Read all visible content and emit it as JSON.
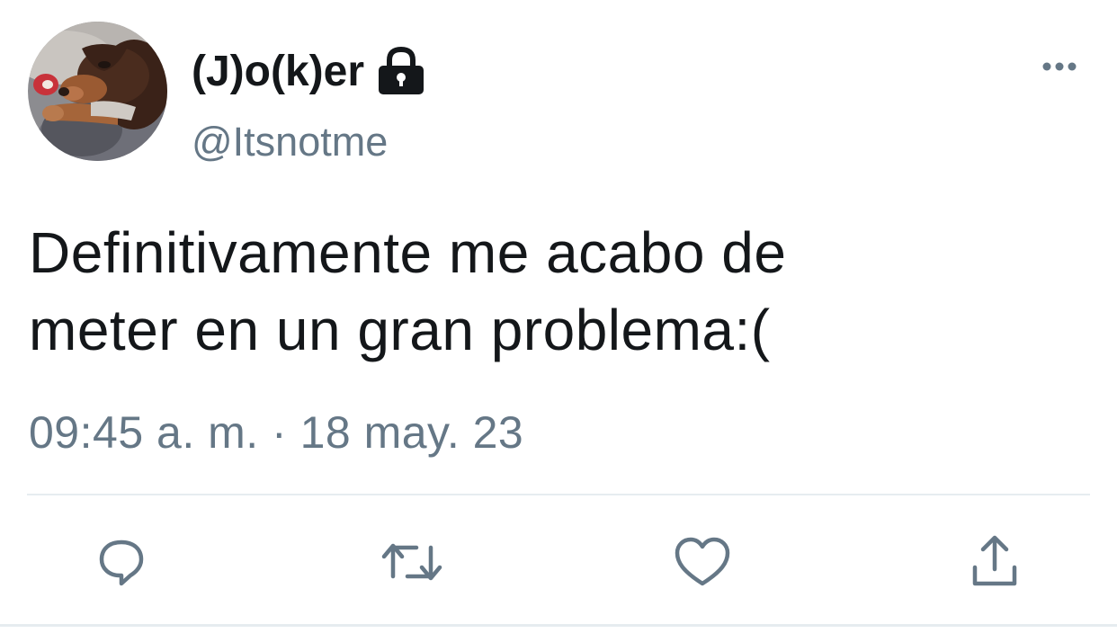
{
  "author": {
    "display_name": "(J)o(k)er",
    "handle": "@Itsnotme",
    "protected_icon": "lock-icon",
    "avatar": "puppy-photo"
  },
  "tweet": {
    "text_line_1": "Definitivamente me acabo de",
    "text_line_2": "meter en un gran problema:(",
    "timestamp": "09:45 a. m. · 18 may. 23"
  },
  "actions": {
    "reply_icon": "reply-icon",
    "retweet_icon": "retweet-icon",
    "like_icon": "like-icon",
    "share_icon": "share-icon",
    "more_icon": "more-icon"
  },
  "colors": {
    "primary_text": "#14171a",
    "secondary_text": "#657786",
    "icon": "#657786",
    "divider": "#e6ecf0"
  }
}
